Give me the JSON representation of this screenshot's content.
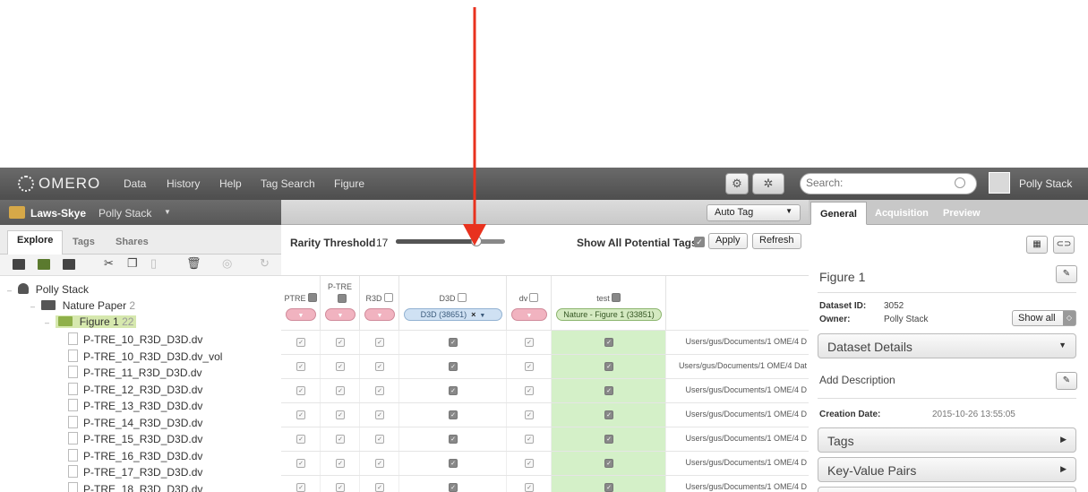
{
  "topbar": {
    "logo": "OMERO",
    "nav": [
      "Data",
      "History",
      "Help",
      "Tag Search",
      "Figure"
    ],
    "search_placeholder": "Search:",
    "user": "Polly Stack"
  },
  "left": {
    "group_name": "Laws-Skye",
    "group_user": "Polly Stack",
    "tabs": [
      "Explore",
      "Tags",
      "Shares"
    ],
    "tree": {
      "user": "Polly Stack",
      "project": "Nature Paper",
      "project_count": "2",
      "dataset": "Figure 1",
      "dataset_count": "22",
      "files": [
        "P-TRE_10_R3D_D3D.dv",
        "P-TRE_10_R3D_D3D.dv_vol",
        "P-TRE_11_R3D_D3D.dv",
        "P-TRE_12_R3D_D3D.dv",
        "P-TRE_13_R3D_D3D.dv",
        "P-TRE_14_R3D_D3D.dv",
        "P-TRE_15_R3D_D3D.dv",
        "P-TRE_16_R3D_D3D.dv",
        "P-TRE_17_R3D_D3D.dv",
        "P-TRE_18_R3D_D3D.dv"
      ]
    }
  },
  "center": {
    "autotag_label": "Auto Tag",
    "rarity_label": "Rarity Threshold",
    "rarity_value": "17",
    "rarity_slider_fraction": 0.74,
    "show_all_label": "Show All Potential Tags",
    "apply_label": "Apply",
    "refresh_label": "Refresh",
    "columns": [
      {
        "name": "PTRE",
        "checked": true,
        "tag": "",
        "tag_style": "pink"
      },
      {
        "name": "P-TRE",
        "checked": true,
        "tag": "",
        "tag_style": "pink"
      },
      {
        "name": "R3D",
        "checked": false,
        "tag": "",
        "tag_style": "pink"
      },
      {
        "name": "D3D",
        "checked": false,
        "tag": "D3D (38651)",
        "tag_style": "blue"
      },
      {
        "name": "dv",
        "checked": false,
        "tag": "",
        "tag_style": "pink"
      },
      {
        "name": "test",
        "checked": true,
        "tag": "Nature - Figure 1 (33851)",
        "tag_style": "green"
      }
    ],
    "paths": [
      "Users/gus/Documents/1 OME/4 D",
      "Users/gus/Documents/1 OME/4 Dat",
      "Users/gus/Documents/1 OME/4 D",
      "Users/gus/Documents/1 OME/4 D",
      "Users/gus/Documents/1 OME/4 D",
      "Users/gus/Documents/1 OME/4 D",
      "Users/gus/Documents/1 OME/4 D"
    ]
  },
  "right": {
    "tabs": [
      "General",
      "Acquisition",
      "Preview"
    ],
    "title": "Figure 1",
    "dataset_id_label": "Dataset ID:",
    "dataset_id": "3052",
    "owner_label": "Owner:",
    "owner": "Polly Stack",
    "show_all": "Show all",
    "details_label": "Dataset Details",
    "add_description": "Add Description",
    "creation_label": "Creation Date:",
    "creation_date": "2015-10-26 13:55:05",
    "tags_label": "Tags",
    "kvp_label": "Key-Value Pairs"
  },
  "colors": {
    "arrow": "#e8321e",
    "topbar": "#5a5a5a",
    "test_column": "#d4f0c8"
  }
}
